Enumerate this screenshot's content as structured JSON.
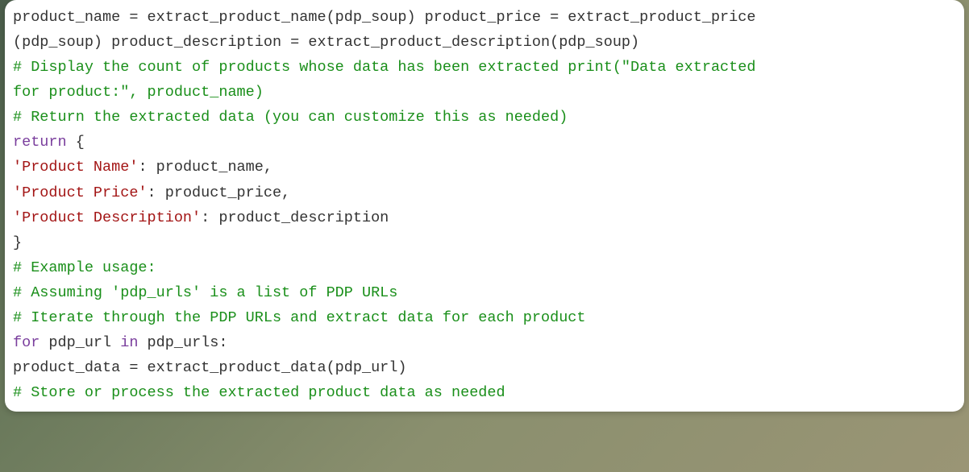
{
  "code": {
    "l1a": "product_name = extract_product_name(pdp_soup) product_price = extract_product_price",
    "l1b": "(pdp_soup) product_description = extract_product_description(pdp_soup)",
    "l2a": "# Display the count of products whose data has been extracted print(\"Data extracted",
    "l2b": "for product:\", product_name)",
    "l3": "# Return the extracted data (you can customize this as needed)",
    "l4_kw": "return",
    "l4_after": " {",
    "l5_key": "'Product Name'",
    "l5_rest": ": product_name,",
    "l6_key": "'Product Price'",
    "l6_rest": ": product_price,",
    "l7_key": "'Product Description'",
    "l7_rest": ": product_description",
    "l8": "}",
    "l9": "# Example usage:",
    "l10": "# Assuming 'pdp_urls' is a list of PDP URLs",
    "l11": "# Iterate through the PDP URLs and extract data for each product",
    "l12_kw": "for",
    "l12_mid": " pdp_url ",
    "l12_kw2": "in",
    "l12_end": " pdp_urls:",
    "l13": "product_data = extract_product_data(pdp_url)",
    "l14": "# Store or process the extracted product data as needed"
  }
}
